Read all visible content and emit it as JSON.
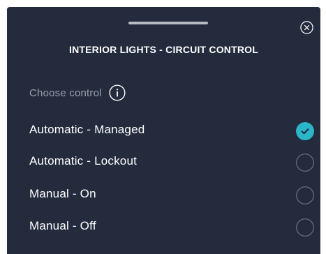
{
  "dialog": {
    "title": "INTERIOR LIGHTS - CIRCUIT CONTROL",
    "choose_label": "Choose control",
    "close_icon": "close-icon",
    "info_icon": "info-icon"
  },
  "options": [
    {
      "label": "Automatic - Managed",
      "selected": true
    },
    {
      "label": "Automatic - Lockout",
      "selected": false
    },
    {
      "label": "Manual - On",
      "selected": false
    },
    {
      "label": "Manual - Off",
      "selected": false
    }
  ],
  "colors": {
    "background": "#242b3d",
    "accent": "#2bb5c8",
    "muted_text": "#9aa0ad",
    "radio_outline": "#6b7180"
  }
}
